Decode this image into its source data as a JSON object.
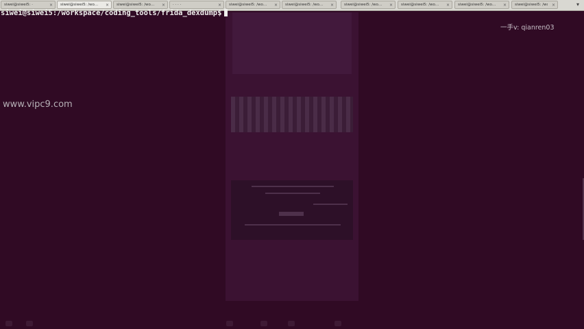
{
  "tabs": [
    {
      "label": "siwei@siwei5: ·",
      "active": false
    },
    {
      "label": "siwei@siwei5: /wo...",
      "active": true
    },
    {
      "label": "siwei@siwei5: /wo...",
      "active": false
    },
    {
      "label": "· · · ·",
      "active": false
    },
    {
      "label": "siwei@siwei5: /wo...",
      "active": false
    },
    {
      "label": "siwei@siwei5: /wo...",
      "active": false
    },
    {
      "label": "siwei@siwei5: /wo...",
      "active": false
    },
    {
      "label": "siwei@siwei5: /wo...",
      "active": false
    },
    {
      "label": "siwei@siwei5: /wo...",
      "active": false
    },
    {
      "label": "siwei@siwei5: /wo...",
      "active": false
    }
  ],
  "tab_close_glyph": "×",
  "tab_scroll_glyph": "▾",
  "terminal": {
    "prompt": "siwei@siwei5:/workspace/coding_tools/frida_dexdump$"
  },
  "watermarks": {
    "left": "www.vipc9.com",
    "right": "一手v: qianren03"
  },
  "colors": {
    "terminal_bg": "#300a24",
    "terminal_fg": "#eeeeec",
    "tabbar_bg": "#d9d8d2"
  }
}
